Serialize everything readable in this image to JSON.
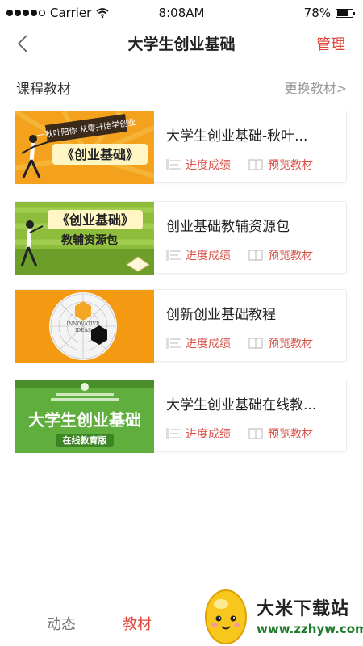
{
  "status_bar": {
    "carrier": "Carrier",
    "time": "8:08AM",
    "battery": "78%",
    "battery_level": 0.78
  },
  "nav": {
    "title": "大学生创业基础",
    "manage_label": "管理"
  },
  "section": {
    "title": "课程教材",
    "change_label": "更换教材>"
  },
  "courses": [
    {
      "title": "大学生创业基础-秋叶...",
      "cover_text_1": "一秋叶陪你 从零开始学创业",
      "cover_text_2": "《创业基础》",
      "progress_label": "进度成绩",
      "preview_label": "预览教材"
    },
    {
      "title": "创业基础教辅资源包",
      "cover_text_1": "《创业基础》",
      "cover_text_2": "教辅资源包",
      "progress_label": "进度成绩",
      "preview_label": "预览教材"
    },
    {
      "title": "创新创业基础教程",
      "cover_text_1": "INNOVATIVE",
      "cover_text_2": "IDEAS",
      "progress_label": "进度成绩",
      "preview_label": "预览教材"
    },
    {
      "title": "大学生创业基础在线教...",
      "cover_text_1": "大学生创业基础",
      "cover_text_2": "在线教育版",
      "progress_label": "进度成绩",
      "preview_label": "预览教材"
    }
  ],
  "tabs": [
    {
      "label": "动态"
    },
    {
      "label": "教材"
    }
  ],
  "watermark": {
    "name": "大米下载站",
    "url": "www.zzhyw.com"
  },
  "colors": {
    "accent": "#e0453b",
    "muted": "#999999",
    "cover_orange": "#f5a623",
    "cover_green": "#7cb342"
  }
}
